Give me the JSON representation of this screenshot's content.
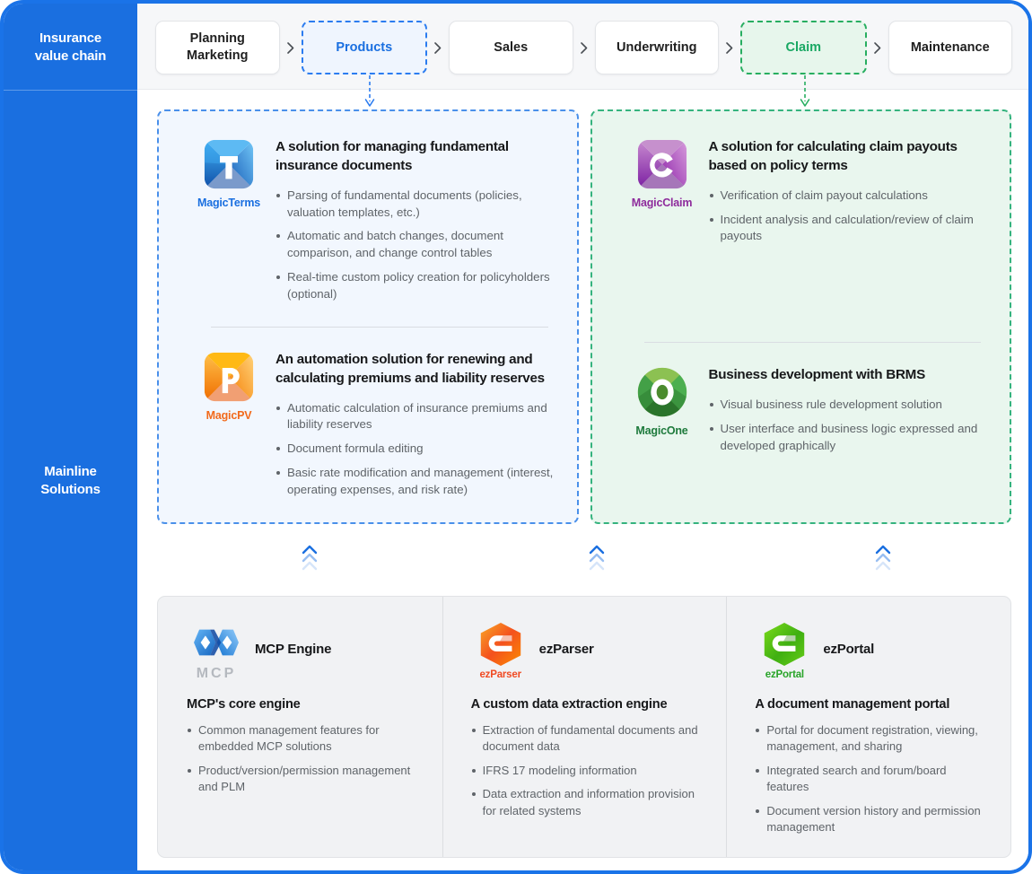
{
  "rail": {
    "top_label": "Insurance\nvalue chain",
    "bottom_label": "Mainline\nSolutions",
    "bg_color": "#1a6fe0"
  },
  "value_chain": {
    "separator_icon": "chevron-right-icon",
    "items": [
      {
        "label": "Planning\nMarketing",
        "state": "normal"
      },
      {
        "label": "Products",
        "state": "highlight-blue",
        "color": "#1a6fe0"
      },
      {
        "label": "Sales",
        "state": "normal"
      },
      {
        "label": "Underwriting",
        "state": "normal"
      },
      {
        "label": "Claim",
        "state": "highlight-green",
        "color": "#19a863"
      },
      {
        "label": "Maintenance",
        "state": "normal"
      }
    ]
  },
  "panels": [
    {
      "id": "products-panel",
      "accent": "#4a90ea",
      "background": "#f2f7fe",
      "products": [
        {
          "logo_icon": "magicterms-logo-icon",
          "logo_letter": "T",
          "name": "MagicTerms",
          "name_color": "#1a6fe0",
          "title": "A solution for managing fundamental insurance documents",
          "features": [
            "Parsing of fundamental documents (policies, valuation templates, etc.)",
            "Automatic and batch changes, document comparison, and change control tables",
            "Real-time custom policy creation for policyholders (optional)"
          ]
        },
        {
          "logo_icon": "magicpv-logo-icon",
          "logo_letter": "P",
          "name": "MagicPV",
          "name_color": "#f26a1b",
          "title": "An automation solution for renewing and calculating premiums and liability reserves",
          "features": [
            "Automatic calculation of insurance premiums and liability reserves",
            "Document formula editing",
            "Basic rate modification and management (interest, operating expenses, and risk rate)"
          ]
        }
      ]
    },
    {
      "id": "claim-panel",
      "accent": "#35b37e",
      "background": "#e9f6ee",
      "products": [
        {
          "logo_icon": "magicclaim-logo-icon",
          "logo_letter": "C",
          "name": "MagicClaim",
          "name_color": "#8e2c9c",
          "title": "A solution for calculating claim payouts based on policy terms",
          "features": [
            "Verification of claim payout calculations",
            "Incident analysis and calculation/review of claim payouts"
          ]
        },
        {
          "logo_icon": "magicone-logo-icon",
          "logo_letter": "O",
          "name": "MagicOne",
          "name_color": "#1e7a3c",
          "title": "Business development with BRMS",
          "features": [
            "Visual business rule development solution",
            "User interface and business logic expressed and developed graphically"
          ]
        }
      ]
    }
  ],
  "chevron_icon": "chevron-up-stack-icon",
  "foundation": [
    {
      "logo_icon": "mcp-logo-icon",
      "logo_name": "MCP",
      "logo_name_color": "#b5b9bf",
      "label": "MCP Engine",
      "title": "MCP's core engine",
      "features": [
        "Common management features for embedded MCP solutions",
        "Product/version/permission management and PLM"
      ]
    },
    {
      "logo_icon": "ezparser-logo-icon",
      "logo_name": "ezParser",
      "logo_name_color": "#f04a22",
      "label": "ezParser",
      "title": "A custom data extraction engine",
      "features": [
        "Extraction of fundamental documents and document data",
        "IFRS 17 modeling information",
        "Data extraction and information provision for related systems"
      ]
    },
    {
      "logo_icon": "ezportal-logo-icon",
      "logo_name": "ezPortal",
      "logo_name_color": "#28a428",
      "label": "ezPortal",
      "title": "A document management portal",
      "features": [
        "Portal for document registration, viewing, management, and sharing",
        "Integrated search and forum/board features",
        "Document version history and permission management"
      ]
    }
  ]
}
